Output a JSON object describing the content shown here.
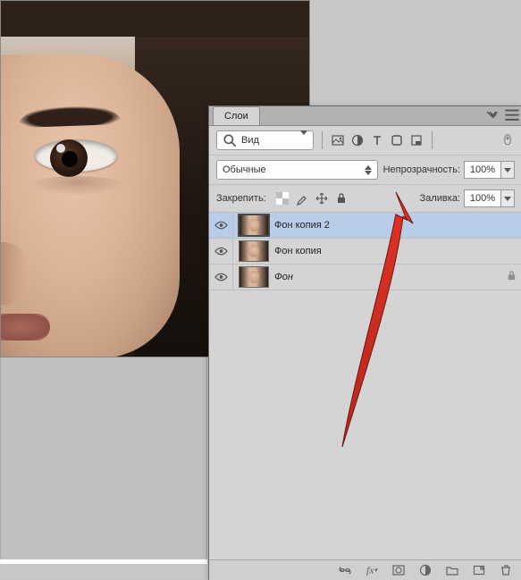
{
  "panel": {
    "tab": "Слои",
    "search_mode": "Вид",
    "filter_icons": [
      "image-icon",
      "adjustments-icon",
      "type-icon",
      "shape-icon",
      "smartobject-icon"
    ],
    "blend_mode": "Обычные",
    "opacity_label": "Непрозрачность:",
    "opacity_value": "100%",
    "lock_label": "Закрепить:",
    "fill_label": "Заливка:",
    "fill_value": "100%",
    "layers": [
      {
        "name": "Фон копия 2",
        "visible": true,
        "selected": true,
        "locked": false,
        "italic": false
      },
      {
        "name": "Фон копия",
        "visible": true,
        "selected": false,
        "locked": false,
        "italic": false
      },
      {
        "name": "Фон",
        "visible": true,
        "selected": false,
        "locked": true,
        "italic": true
      }
    ]
  }
}
